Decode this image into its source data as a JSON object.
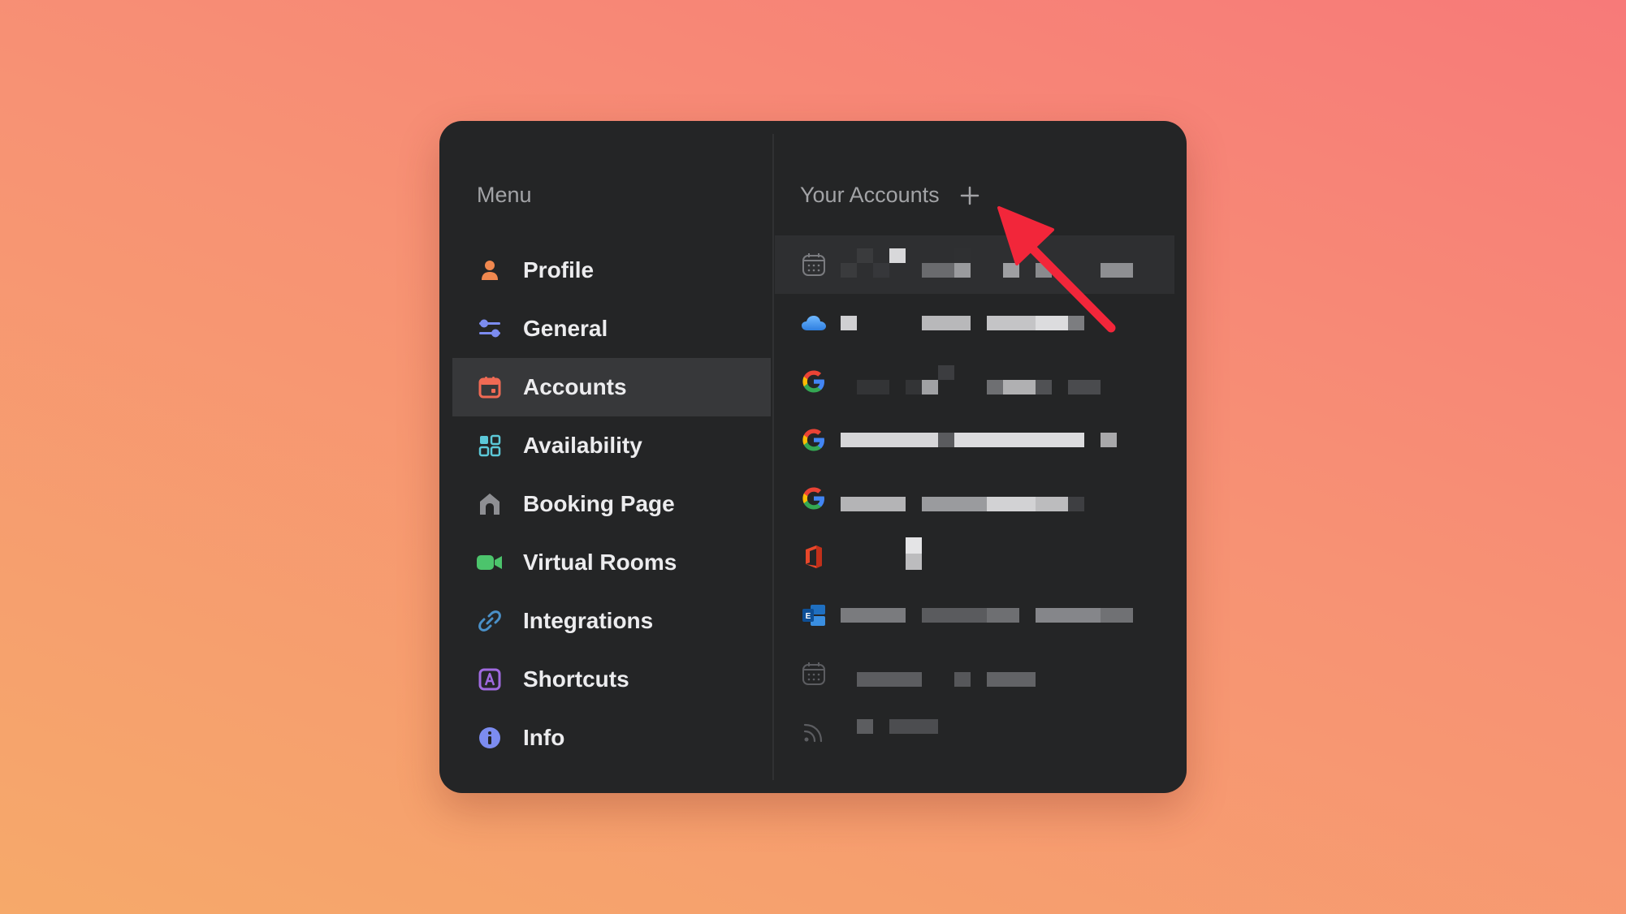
{
  "menu": {
    "title": "Menu",
    "items": [
      {
        "label": "Profile",
        "icon": "person-icon",
        "color": "#f0884f"
      },
      {
        "label": "General",
        "icon": "sliders-icon",
        "color": "#7c8cf0"
      },
      {
        "label": "Accounts",
        "icon": "calendar-icon",
        "color": "#f06a54",
        "active": true
      },
      {
        "label": "Availability",
        "icon": "grid-icon",
        "color": "#5cc8d8"
      },
      {
        "label": "Booking Page",
        "icon": "house-icon",
        "color": "#8e8f93"
      },
      {
        "label": "Virtual Rooms",
        "icon": "video-camera-icon",
        "color": "#4cc46c"
      },
      {
        "label": "Integrations",
        "icon": "link-icon",
        "color": "#4a90c8"
      },
      {
        "label": "Shortcuts",
        "icon": "keyboard-a-icon",
        "color": "#a06ae0"
      },
      {
        "label": "Info",
        "icon": "info-icon",
        "color": "#7c8cf0"
      }
    ]
  },
  "accounts": {
    "title": "Your Accounts",
    "add_icon": "plus-icon",
    "rows": [
      {
        "icon": "calendar-outline-icon",
        "redacted": true
      },
      {
        "icon": "icloud-icon",
        "redacted": true
      },
      {
        "icon": "google-icon",
        "redacted": true
      },
      {
        "icon": "google-icon",
        "redacted": true
      },
      {
        "icon": "google-icon",
        "redacted": true
      },
      {
        "icon": "office-icon",
        "redacted": true
      },
      {
        "icon": "exchange-icon",
        "redacted": true
      },
      {
        "icon": "calendar-outline-icon",
        "redacted": true
      },
      {
        "icon": "rss-feed-icon",
        "redacted": true
      }
    ]
  },
  "annotation": {
    "icon": "red-arrow-icon",
    "color": "#f2263a"
  }
}
